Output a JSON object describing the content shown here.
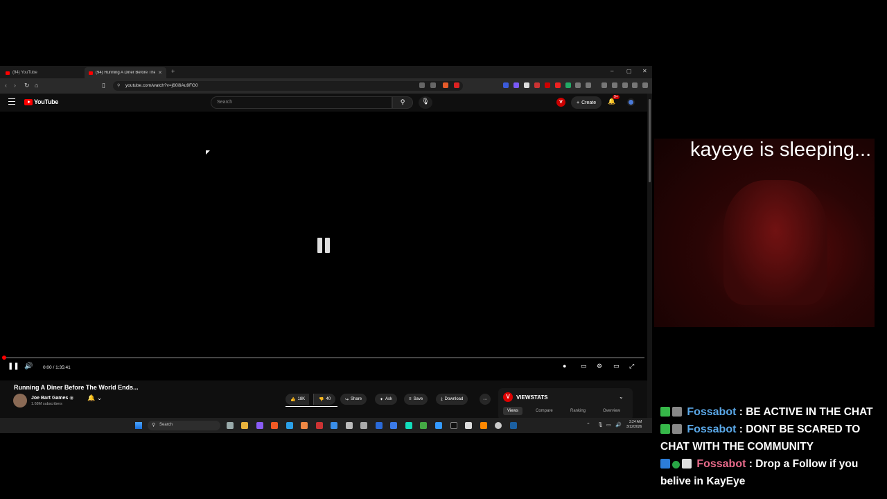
{
  "browser": {
    "tabs": [
      {
        "title": "(94) YouTube"
      },
      {
        "title": "(94) Running A Diner Before The"
      }
    ],
    "url": "youtube.com/watch?v=j60i6Au9FG0"
  },
  "youtube": {
    "logo_text": "YouTube",
    "search_placeholder": "Search",
    "create_label": "Create",
    "notification_count": "9+",
    "v_badge": "V"
  },
  "player": {
    "time": "0:00 / 1:35:41",
    "progress_fraction": 0
  },
  "video": {
    "title": "Running A Diner Before The World Ends...",
    "channel": "Joe Bart Games",
    "subscribers": "1.68M subscribers",
    "likes": "18K",
    "dislikes": "40",
    "share_label": "Share",
    "ask_label": "Ask",
    "save_label": "Save",
    "download_label": "Download"
  },
  "viewstats": {
    "logo": "V",
    "title": "VIEWSTATS",
    "tabs": [
      "Views",
      "Compare",
      "Ranking",
      "Overview"
    ]
  },
  "taskbar": {
    "search_label": "Search",
    "time": "3:24 AM",
    "date": "3/12/2026"
  },
  "overlay": {
    "status_text": "kayeye is sleeping..."
  },
  "chat": [
    {
      "user": "Fossabot",
      "message": ": BE ACTIVE IN THE CHAT"
    },
    {
      "user": "Fossabot",
      "message": ": DONT BE SCARED TO CHAT WITH THE COMMUNITY"
    },
    {
      "user": "Fossabot",
      "message": ": Drop a Follow if you belive in KayEye"
    }
  ]
}
